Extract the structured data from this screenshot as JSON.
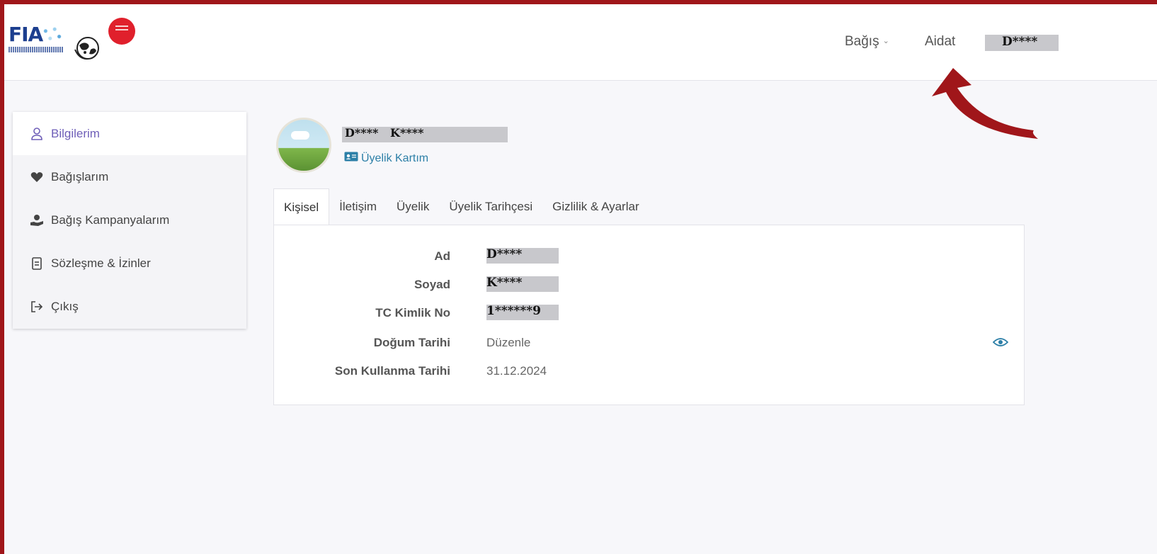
{
  "header": {
    "nav_bagis": "Bağış",
    "nav_aidat": "Aidat",
    "user_name": "D****"
  },
  "sidebar": {
    "items": [
      {
        "label": "Bilgilerim",
        "icon": "user-icon",
        "active": true
      },
      {
        "label": "Bağışlarım",
        "icon": "heart-icon",
        "active": false
      },
      {
        "label": "Bağış Kampanyalarım",
        "icon": "hand-icon",
        "active": false
      },
      {
        "label": "Sözleşme & İzinler",
        "icon": "document-icon",
        "active": false
      },
      {
        "label": "Çıkış",
        "icon": "logout-icon",
        "active": false
      }
    ]
  },
  "profile": {
    "name": "D****   K****",
    "card_link": "Üyelik Kartım"
  },
  "tabs": [
    {
      "label": "Kişisel",
      "active": true
    },
    {
      "label": "İletişim",
      "active": false
    },
    {
      "label": "Üyelik",
      "active": false
    },
    {
      "label": "Üyelik Tarihçesi",
      "active": false
    },
    {
      "label": "Gizlilik & Ayarlar",
      "active": false
    }
  ],
  "fields": [
    {
      "label": "Ad",
      "value": "D****",
      "masked": true
    },
    {
      "label": "Soyad",
      "value": "K****",
      "masked": true
    },
    {
      "label": "TC Kimlik No",
      "value": "1******9",
      "masked": true
    },
    {
      "label": "Doğum Tarihi",
      "value": "Düzenle",
      "masked": false
    },
    {
      "label": "Son Kullanma Tarihi",
      "value": "31.12.2024",
      "masked": false
    }
  ],
  "colors": {
    "frame": "#a0161a",
    "accent": "#6f5fb8",
    "link": "#2c7fa7"
  }
}
